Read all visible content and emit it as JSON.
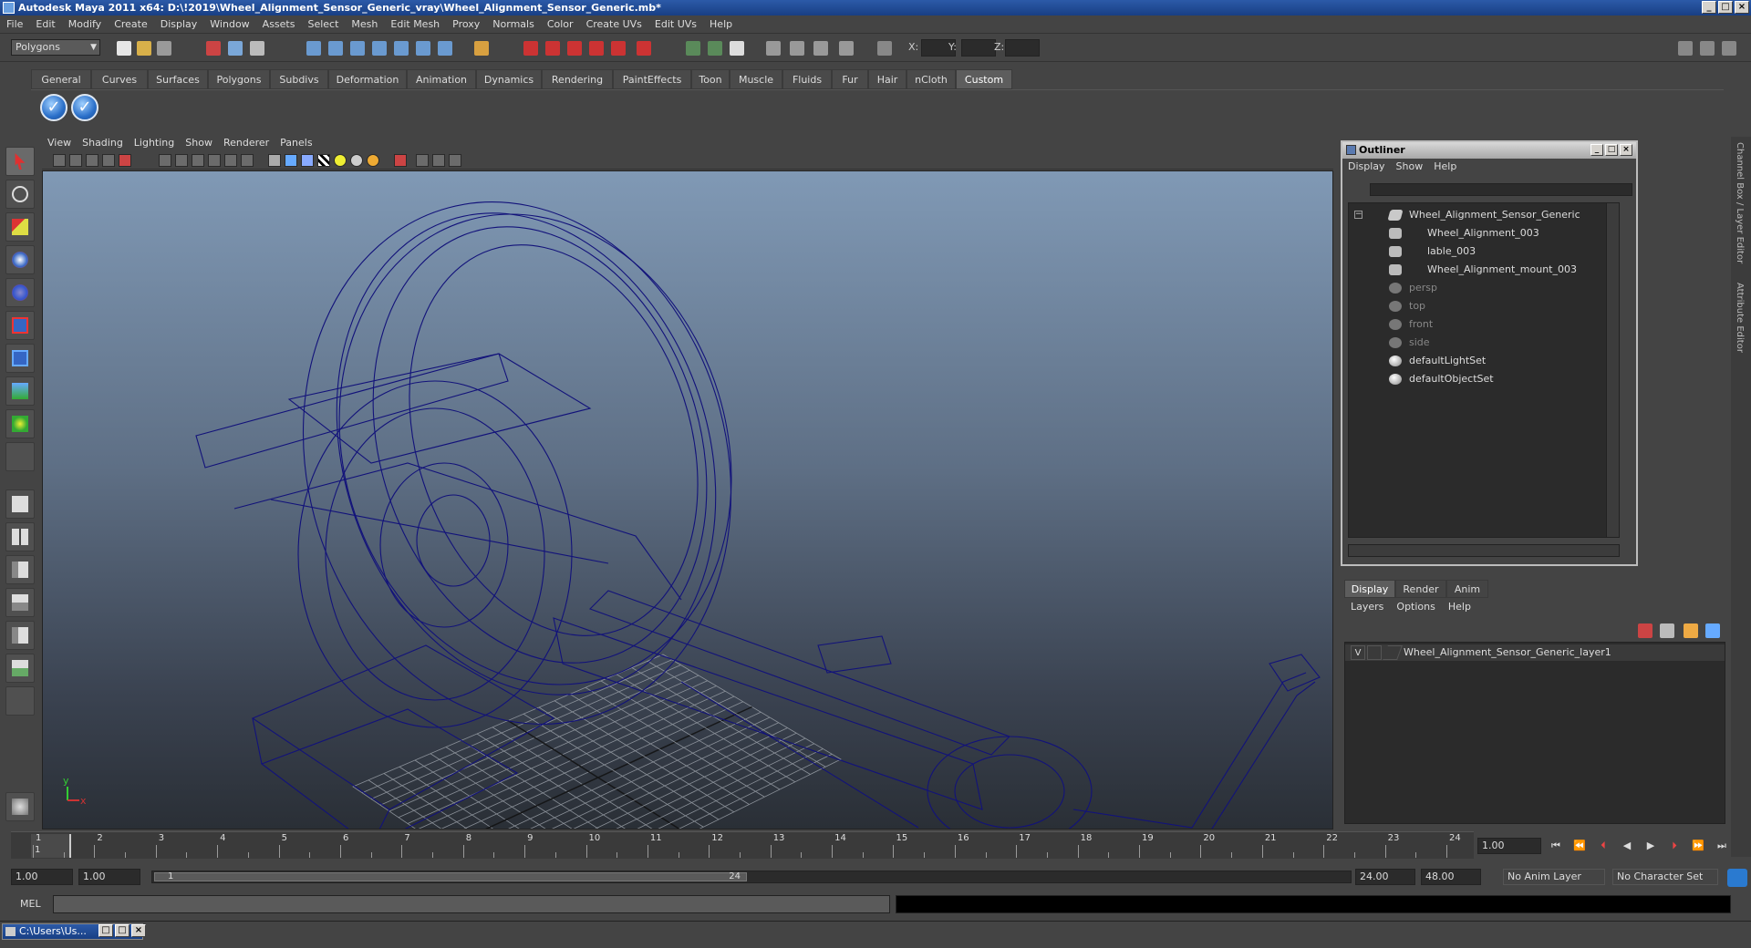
{
  "window": {
    "title": "Autodesk Maya 2011 x64: D:\\!2019\\Wheel_Alignment_Sensor_Generic_vray\\Wheel_Alignment_Sensor_Generic.mb*"
  },
  "menu": [
    "File",
    "Edit",
    "Modify",
    "Create",
    "Display",
    "Window",
    "Assets",
    "Select",
    "Mesh",
    "Edit Mesh",
    "Proxy",
    "Normals",
    "Color",
    "Create UVs",
    "Edit UVs",
    "Help"
  ],
  "status": {
    "mode": "Polygons",
    "x_label": "X:",
    "y_label": "Y:",
    "z_label": "Z:"
  },
  "shelf": {
    "tabs": [
      "General",
      "Curves",
      "Surfaces",
      "Polygons",
      "Subdivs",
      "Deformation",
      "Animation",
      "Dynamics",
      "Rendering",
      "PaintEffects",
      "Toon",
      "Muscle",
      "Fluids",
      "Fur",
      "Hair",
      "nCloth",
      "Custom"
    ],
    "active_tab": "Custom"
  },
  "viewport": {
    "menu": [
      "View",
      "Shading",
      "Lighting",
      "Show",
      "Renderer",
      "Panels"
    ],
    "axis_x": "x",
    "axis_y": "y",
    "wire_color": "#12127a"
  },
  "outliner": {
    "title": "Outliner",
    "menu": [
      "Display",
      "Show",
      "Help"
    ],
    "items": [
      {
        "label": "Wheel_Alignment_Sensor_Generic",
        "indent": 0,
        "icon": "group-icon",
        "dim": false
      },
      {
        "label": "Wheel_Alignment_003",
        "indent": 1,
        "icon": "mesh-icon",
        "dim": false
      },
      {
        "label": "lable_003",
        "indent": 1,
        "icon": "mesh-icon",
        "dim": false
      },
      {
        "label": "Wheel_Alignment_mount_003",
        "indent": 1,
        "icon": "mesh-icon",
        "dim": false
      },
      {
        "label": "persp",
        "indent": 0,
        "icon": "camera-icon",
        "dim": true
      },
      {
        "label": "top",
        "indent": 0,
        "icon": "camera-icon",
        "dim": true
      },
      {
        "label": "front",
        "indent": 0,
        "icon": "camera-icon",
        "dim": true
      },
      {
        "label": "side",
        "indent": 0,
        "icon": "camera-icon",
        "dim": true
      },
      {
        "label": "defaultLightSet",
        "indent": 0,
        "icon": "set-icon",
        "dim": false
      },
      {
        "label": "defaultObjectSet",
        "indent": 0,
        "icon": "set-icon",
        "dim": false
      }
    ]
  },
  "layers": {
    "tabs": [
      "Display",
      "Render",
      "Anim"
    ],
    "active_tab": "Display",
    "menu": [
      "Layers",
      "Options",
      "Help"
    ],
    "rows": [
      {
        "visible": "V",
        "name": "Wheel_Alignment_Sensor_Generic_layer1"
      }
    ]
  },
  "right_strip": {
    "channel_box": "Channel Box / Layer Editor",
    "attr_editor": "Attribute Editor"
  },
  "timeline": {
    "ticks": [
      "1",
      "2",
      "3",
      "4",
      "5",
      "6",
      "7",
      "8",
      "9",
      "10",
      "11",
      "12",
      "13",
      "14",
      "15",
      "16",
      "17",
      "18",
      "19",
      "20",
      "21",
      "22",
      "23",
      "24"
    ],
    "current_frame": "1.00",
    "marker": "1"
  },
  "range": {
    "start": "1.00",
    "playback_start": "1.00",
    "slider_start": "1",
    "slider_end": "24",
    "playback_end": "24.00",
    "end": "48.00",
    "anim_layer": "No Anim Layer",
    "character_set": "No Character Set"
  },
  "command": {
    "label": "MEL"
  },
  "taskbar": {
    "item": "C:\\Users\\Us..."
  }
}
